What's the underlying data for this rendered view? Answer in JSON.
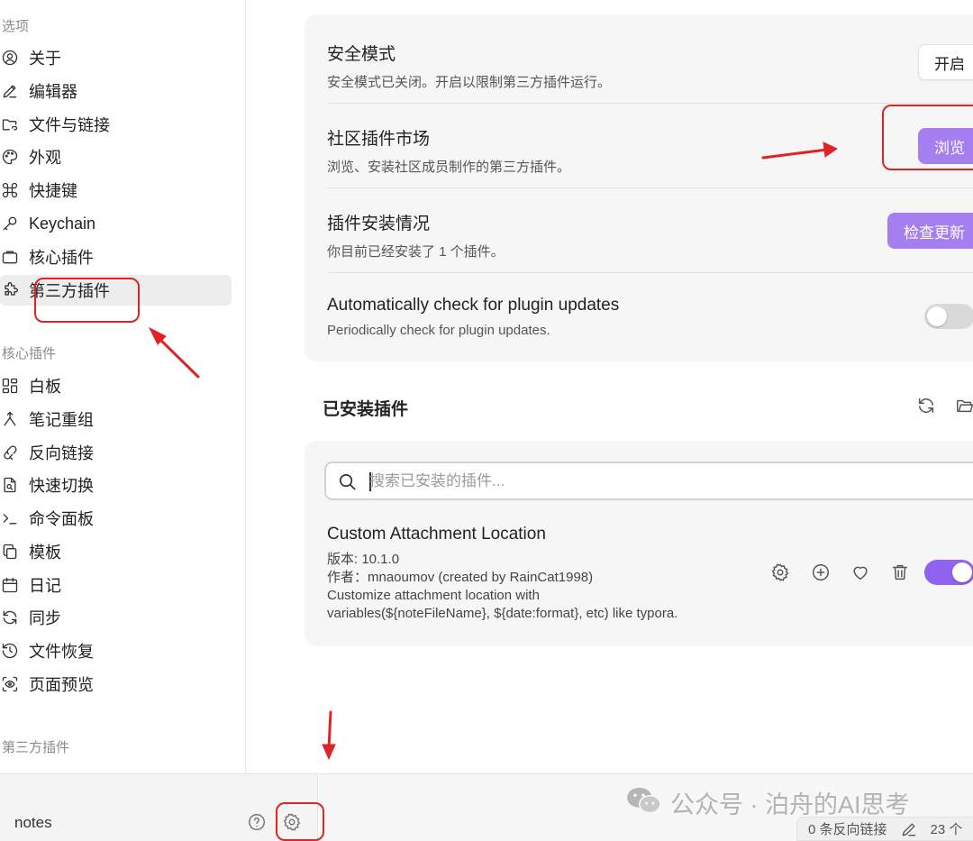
{
  "sidebar": {
    "options_header": "选项",
    "options": [
      {
        "label": "关于",
        "icon": "user-circle-icon"
      },
      {
        "label": "编辑器",
        "icon": "pencil-icon"
      },
      {
        "label": "文件与链接",
        "icon": "folder-link-icon"
      },
      {
        "label": "外观",
        "icon": "palette-icon"
      },
      {
        "label": "快捷键",
        "icon": "command-icon"
      },
      {
        "label": "Keychain",
        "icon": "key-icon"
      },
      {
        "label": "核心插件",
        "icon": "briefcase-icon"
      },
      {
        "label": "第三方插件",
        "icon": "puzzle-icon",
        "active": true
      }
    ],
    "core_header": "核心插件",
    "core": [
      {
        "label": "白板",
        "icon": "canvas-grid-icon"
      },
      {
        "label": "笔记重组",
        "icon": "merge-icon"
      },
      {
        "label": "反向链接",
        "icon": "backlink-icon"
      },
      {
        "label": "快速切换",
        "icon": "file-search-icon"
      },
      {
        "label": "命令面板",
        "icon": "terminal-icon"
      },
      {
        "label": "模板",
        "icon": "copy-icon"
      },
      {
        "label": "日记",
        "icon": "calendar-icon"
      },
      {
        "label": "同步",
        "icon": "sync-icon"
      },
      {
        "label": "文件恢复",
        "icon": "history-icon"
      },
      {
        "label": "页面预览",
        "icon": "scan-eye-icon"
      }
    ],
    "third_party_header": "第三方插件"
  },
  "settings": {
    "safe_mode": {
      "title": "安全模式",
      "desc": "安全模式已关闭。开启以限制第三方插件运行。",
      "button": "开启"
    },
    "community": {
      "title": "社区插件市场",
      "desc": "浏览、安装社区成员制作的第三方插件。",
      "button": "浏览"
    },
    "installed_status": {
      "title": "插件安装情况",
      "desc": "你目前已经安装了 1 个插件。",
      "button": "检查更新"
    },
    "auto_check": {
      "title": "Automatically check for plugin updates",
      "desc": "Periodically check for plugin updates.",
      "enabled": false
    }
  },
  "installed": {
    "heading": "已安装插件",
    "search_placeholder": "搜索已安装的插件...",
    "plugins": [
      {
        "name": "Custom Attachment Location",
        "version": "版本: 10.1.0",
        "author": "作者：mnaoumov (created by RainCat1998)",
        "desc_line1": "Customize attachment location with",
        "desc_line2": "variables(${noteFileName}, ${date:format}, etc) like typora.",
        "enabled": true
      }
    ]
  },
  "bottom": {
    "vault_name": "notes",
    "watermark": "公众号 · 泊舟的AI思考",
    "backlinks": "0 条反向链接",
    "count": "23 个"
  },
  "colors": {
    "accent": "#a57ef0",
    "toggle_on": "#8f62f0",
    "annotation": "#e02424"
  }
}
